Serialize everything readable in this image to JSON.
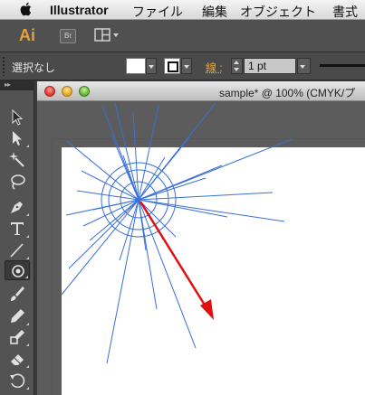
{
  "menubar": {
    "app_name": "Illustrator",
    "items": [
      "ファイル",
      "編集",
      "オブジェクト",
      "書式"
    ]
  },
  "appbar": {
    "logo": "Ai",
    "bridge_label": "Br"
  },
  "control": {
    "selection_label": "選択なし",
    "stroke_label": "線 :",
    "stroke_weight": "1 pt"
  },
  "document": {
    "title": "sample* @ 100% (CMYK/プ"
  },
  "tools": [
    {
      "name": "selection-tool-icon"
    },
    {
      "name": "direct-selection-tool-icon"
    },
    {
      "name": "magic-wand-tool-icon"
    },
    {
      "name": "lasso-tool-icon"
    },
    {
      "name": "pen-tool-icon"
    },
    {
      "name": "type-tool-icon"
    },
    {
      "name": "line-segment-tool-icon"
    },
    {
      "name": "flare-tool-icon"
    },
    {
      "name": "paintbrush-tool-icon"
    },
    {
      "name": "pencil-tool-icon"
    },
    {
      "name": "blob-brush-tool-icon"
    },
    {
      "name": "eraser-tool-icon"
    },
    {
      "name": "rotate-tool-icon"
    }
  ],
  "colors": {
    "accent_ai": "#e7a13a",
    "artwork_lines": "#3a6fd8",
    "arrow": "#e01010",
    "artboard_border": "#c62828"
  }
}
